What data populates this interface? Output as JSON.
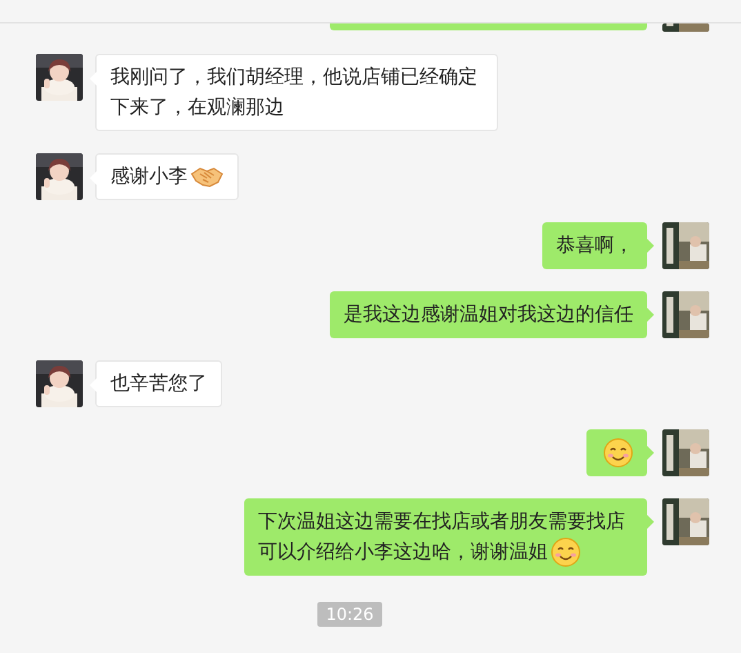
{
  "messages": [
    {
      "kind": "incoming",
      "text": "我刚问了，我们胡经理，他说店铺已经确定下来了，在观澜那边"
    },
    {
      "kind": "incoming",
      "text": "感谢小李",
      "emoji": {
        "kind": "handshake"
      }
    },
    {
      "kind": "outgoing",
      "text": "恭喜啊，"
    },
    {
      "kind": "outgoing",
      "text": "是我这边感谢温姐对我这边的信任"
    },
    {
      "kind": "incoming",
      "text": "也辛苦您了"
    },
    {
      "kind": "outgoing",
      "emoji": {
        "kind": "smile"
      }
    },
    {
      "kind": "outgoing",
      "text": "下次温姐这边需要在找店或者朋友需要找店可以介绍给小李这边哈，谢谢温姐",
      "emoji": {
        "kind": "smile"
      }
    }
  ],
  "timestamp": "10:26"
}
